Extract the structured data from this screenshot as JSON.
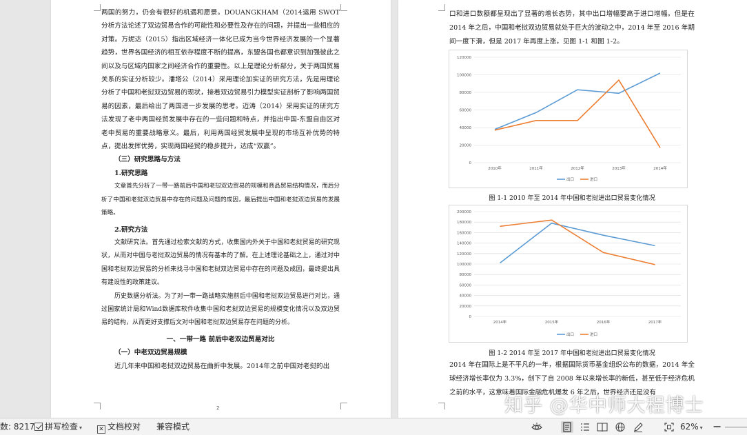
{
  "left_page": {
    "para1": "两国的努力，仍会有很好的机遇和愿景。DOUANGKHAM（2014运用 SWOT 分析方法论述了双边贸易合作的可能性和必要性及存在的问题，并提出一些相应的对策。万妮达（2015）指出区域经济一体化已成为当今世界经济发展的一个显著趋势，世界各国经济的相互依存程度不断的提高，东盟各国也都意识到加强彼此之间以及与区域内国家之间经济合作的重要性。以上是理论分析部分，关于两国贸易关系的实证分析较少。潘塔公（2014）采用理论加实证的研究方法，先是用理论分析了中国和老挝双边贸易的现状，接着双边贸易引力模型实证剖析了影响两国贸易的因素，最后给出了两国进一步发展的思考。迈涛（2014）采用实证的研究方法发现了老中两国经贸发展中存在的一些问题和特点，并指出中国-东盟自由区对老中贸易的重要战略意义。最后，利用两国经贸发展中呈现的市场互补优势的特点，提出发挥优势，实现两国经贸的稳步提升，达成“双赢”。",
    "heading_method": "（三）研究思路与方法",
    "heading_idea": "1.研究思路",
    "para_idea": "文章首先分析了一带一路前后中国和老挝双边贸易的规模和商品贸易结构情况，而后分析了中国和老挝双边贸易中存在的问题及问题的成因，最后提出中国和老挝双边贸易的发展策略。",
    "heading_research": "2.研究方法",
    "para_lit": "文献研究法。首先通过检索文献的方式，收集国内外关于中国和老挝贸易的研究现状，从而对中国与老挝双边贸易的情况有基本的了解。在上述理论基础之上，通过对中国和老挝双边贸易的分析来找寻中国和老挝双边贸易中存在的问题及成因，最终提出具有建设性的政策建议。",
    "para_hist": "历史数据分析法。为了对一带一路战略实施前后中国和老挝双边贸易进行对比，通过国家统计局和Wind数据库软件收集中国和老挝双边贸易的规模变化情况以及双边贸易的结构，从而更好支撑后文对中国和老挝双边贸易存在问题的分析。",
    "heading_chapter": "一、一带一路 前后中老双边贸易对比",
    "heading_scale": "（一）中老双边贸易规模",
    "para_last": "近几年来中国和老挝双边贸易在曲折中发展。2014年之前中国对老挝的出",
    "page_number": "2"
  },
  "right_page": {
    "para_top": "口和进口数额都呈现出了显著的增长态势，其中出口增幅要高于进口增幅。但是在 2014 年之后，中国和老挝双边贸易就处于巨大的波动之中，2014 年至 2016 年期间一度下滑，但是 2017 年再度上涨，见图 1-1 和图 1-2。",
    "caption1": "图 1-1  2010 年至 2014 年中国和老挝进出口贸易变化情况",
    "caption2": "图 1-2  2014 年至 2017 年中国和老挝进出口贸易变化情况",
    "para_bottom": "2014 年在国际上是不平凡的一年，根据国际货币基金组织公布的数据，2014 年全球经济增长率仅为 3.3%，创下了自 2008 年以来增长率的新低，甚至低于经济危机之前的水平，这意味着国际金融危机爆发 6 年之后，世界经济还是没有"
  },
  "chart_data": [
    {
      "type": "line",
      "x": [
        "2010年",
        "2011年",
        "2012年",
        "2013年",
        "2014年"
      ],
      "series": [
        {
          "name": "出口",
          "color": "#5b9bd5",
          "values": [
            38000,
            57000,
            83000,
            79000,
            102000
          ]
        },
        {
          "name": "进口",
          "color": "#ed7d31",
          "values": [
            37000,
            48000,
            48000,
            94000,
            17000
          ]
        }
      ],
      "yticks": [
        0,
        20000,
        40000,
        60000,
        80000,
        100000,
        120000
      ],
      "ylim": [
        0,
        120000
      ],
      "legend": "bottom",
      "grid": true
    },
    {
      "type": "line",
      "x": [
        "2014年",
        "2015年",
        "2016年",
        "2017年"
      ],
      "series": [
        {
          "name": "出口",
          "color": "#5b9bd5",
          "values": [
            102000,
            178000,
            155000,
            135000
          ]
        },
        {
          "name": "进口",
          "color": "#ed7d31",
          "values": [
            172000,
            184000,
            122000,
            99000
          ]
        }
      ],
      "yticks": [
        0,
        20000,
        40000,
        60000,
        80000,
        100000,
        120000,
        140000,
        160000,
        180000,
        200000
      ],
      "ylim": [
        0,
        200000
      ],
      "legend": "bottom",
      "grid": true
    }
  ],
  "statusbar": {
    "word_count": "数: 8217",
    "spell_check": "拼写检查",
    "doc_proof": "文档校对",
    "compat_mode": "兼容模式",
    "zoom": "62%"
  },
  "watermark": "知乎 @华中师大程博士"
}
